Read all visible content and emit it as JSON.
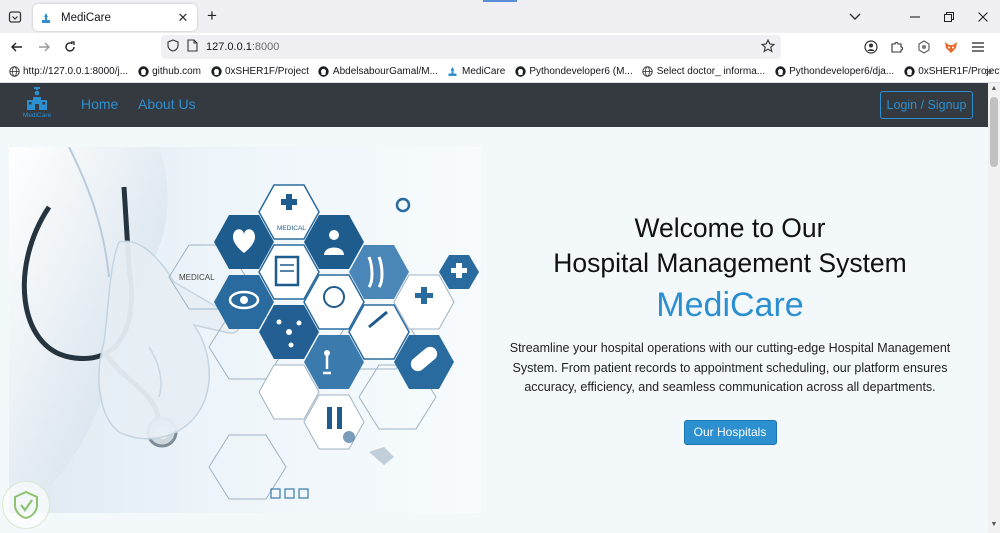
{
  "browser": {
    "tab": {
      "title": "MediCare"
    },
    "url": {
      "host": "127.0.0.1",
      "port": ":8000"
    },
    "bookmarks": [
      {
        "icon": "globe-icon",
        "label": "http://127.0.0.1:8000/j..."
      },
      {
        "icon": "github-icon",
        "label": "github.com"
      },
      {
        "icon": "github-icon",
        "label": "0xSHER1F/Project"
      },
      {
        "icon": "github-icon",
        "label": "AbdelsabourGamal/M..."
      },
      {
        "icon": "medicare-icon",
        "label": "MediCare"
      },
      {
        "icon": "github-icon",
        "label": "Pythondeveloper6 (M..."
      },
      {
        "icon": "globe-icon",
        "label": "Select doctor_ informa..."
      },
      {
        "icon": "github-icon",
        "label": "Pythondeveloper6/dja..."
      },
      {
        "icon": "github-icon",
        "label": "0xSHER1F/Project"
      }
    ]
  },
  "site": {
    "logo_text": "MediCare",
    "nav": {
      "home": "Home",
      "about": "About Us",
      "login": "Login / Signup"
    },
    "hero": {
      "line1": "Welcome to Our",
      "line2": "Hospital Management System",
      "brand": "MediCare",
      "description": "Streamline your hospital operations with our cutting-edge Hospital Management System. From patient records to appointment scheduling, our platform ensures accuracy, efficiency, and seamless communication across all departments.",
      "button": "Our Hospitals"
    },
    "image_labels": {
      "medical": "MEDICAL"
    }
  },
  "colors": {
    "accent": "#2b8fd0",
    "navbar": "#343a40",
    "hero_bg": "#f3f8fb"
  }
}
